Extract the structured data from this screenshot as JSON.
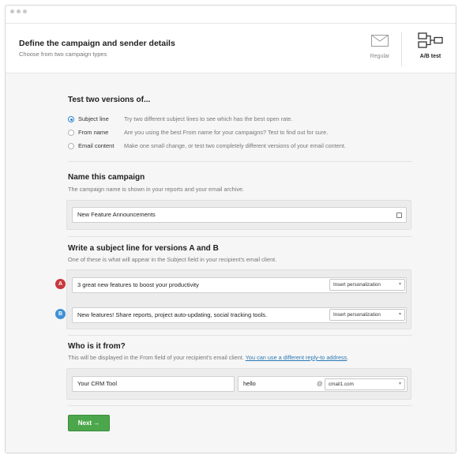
{
  "header": {
    "title": "Define the campaign and sender details",
    "subtitle": "Choose from two campaign types",
    "types": [
      {
        "label": "Regular",
        "icon": "envelope-icon",
        "selected": false
      },
      {
        "label": "A/B test",
        "icon": "ab-test-icon",
        "selected": true
      }
    ]
  },
  "test_section": {
    "title": "Test two versions of...",
    "options": [
      {
        "label": "Subject line",
        "desc": "Try two different subject lines to see which has the best open rate.",
        "checked": true
      },
      {
        "label": "From name",
        "desc": "Are you using the best From name for your campaigns? Test to find out for sure.",
        "checked": false
      },
      {
        "label": "Email content",
        "desc": "Make one small change, or test two completely different versions of your email content.",
        "checked": false
      }
    ]
  },
  "name_section": {
    "title": "Name this campaign",
    "desc": "The campaign name is shown in your reports and your email archive.",
    "value": "New Feature Announcements"
  },
  "subject_section": {
    "title": "Write a subject line for versions A and B",
    "desc": "One of these is what will appear in the Subject field in your recipient's email client.",
    "versions": [
      {
        "badge": "A",
        "value": "3 great new features to boost your productivity",
        "select": "Insert personalization",
        "color": "#c8383d"
      },
      {
        "badge": "B",
        "value": "New features! Share reports, project auto-updating, social tracking tools.",
        "select": "Insert personalization",
        "color": "#3f90d6"
      }
    ]
  },
  "from_section": {
    "title": "Who is it from?",
    "desc": "This will be displayed in the From field of your recipient's email client.",
    "link": "You can use a different reply-to address",
    "desc_end": ".",
    "from_name": "Your CRM Tool",
    "email_user": "hello",
    "at": "@",
    "domain": "cmail1.com"
  },
  "footer": {
    "next_label": "Next →"
  },
  "colors": {
    "accent": "#2f84d4",
    "next_button": "#4ca74c",
    "badge_a": "#c8383d",
    "badge_b": "#3f90d6"
  }
}
